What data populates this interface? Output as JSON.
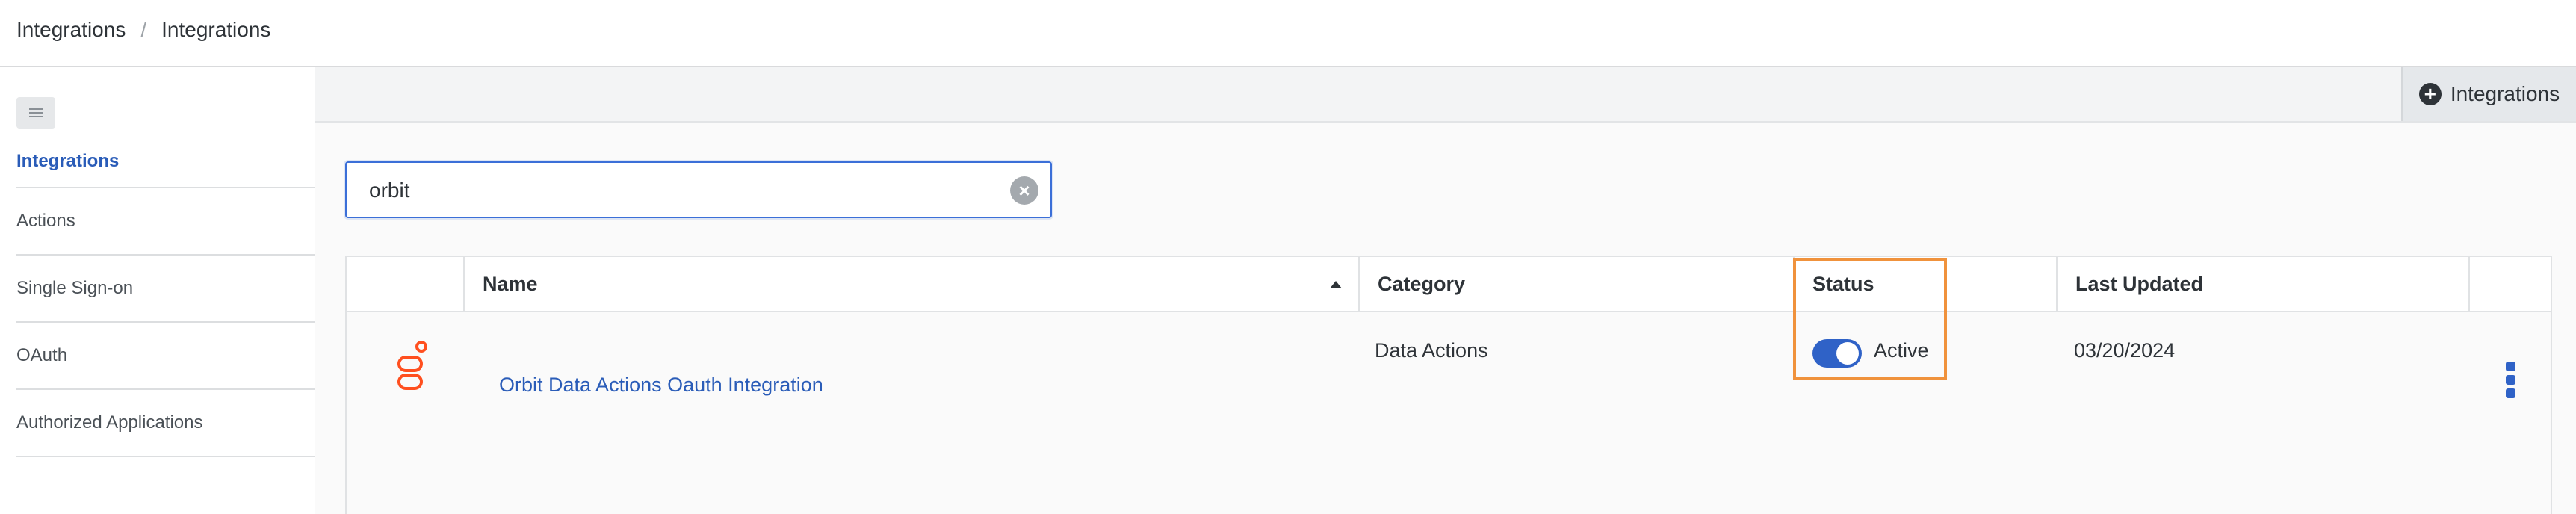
{
  "breadcrumb": {
    "items": [
      "Integrations",
      "Integrations"
    ],
    "separator": "/"
  },
  "sidebar": {
    "items": [
      {
        "label": "Integrations",
        "active": true
      },
      {
        "label": "Actions"
      },
      {
        "label": "Single Sign-on"
      },
      {
        "label": "OAuth"
      },
      {
        "label": "Authorized Applications"
      }
    ]
  },
  "toolbar": {
    "add_label": "Integrations",
    "add_icon": "plus-circle-icon"
  },
  "search": {
    "value": "orbit",
    "clear_icon": "clear-icon"
  },
  "table": {
    "columns": [
      "Name",
      "Category",
      "Status",
      "Last Updated"
    ],
    "sort": {
      "column": "Name",
      "direction": "ascending"
    },
    "rows": [
      {
        "icon": "genesys-logo-icon",
        "name": "Orbit Data Actions Oauth Integration",
        "category": "Data Actions",
        "status": "Active",
        "status_on": true,
        "last_updated": "03/20/2024"
      }
    ]
  },
  "colors": {
    "accent": "#2f62c7",
    "highlight": "#f0923c",
    "logo": "#ff4f1f"
  }
}
